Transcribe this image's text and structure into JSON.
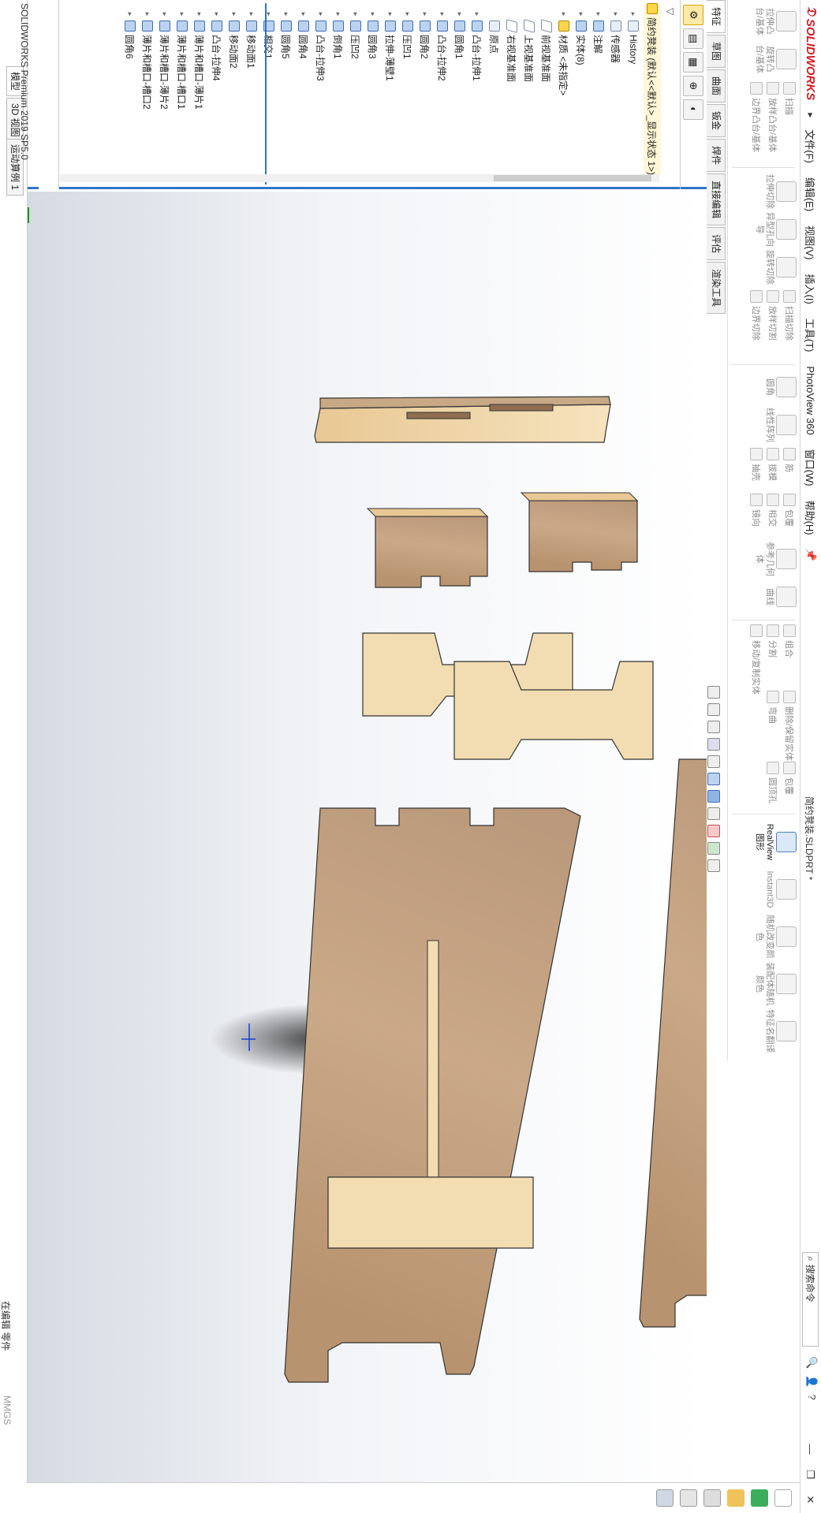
{
  "app": {
    "title": "SOLIDWORKS",
    "document_title": "简约凳装.SLDPRT *",
    "version_status": "SOLIDWORKS Premium 2019 SP5.0",
    "editing_status": "在编辑 零件",
    "units": "MMGS",
    "search_placeholder": "搜索命令"
  },
  "menu": {
    "items": [
      "文件(F)",
      "编辑(E)",
      "视图(V)",
      "插入(I)",
      "工具(T)",
      "PhotoView 360",
      "窗口(W)",
      "帮助(H)"
    ],
    "pin": "📌"
  },
  "ribbon": {
    "groups": [
      {
        "top": "拉伸凸台/基体",
        "bottom": "旋转凸台/基体"
      },
      {
        "top": "扫描",
        "mid": "放样凸台/基体",
        "bottom": "边界凸台/基体"
      },
      {
        "top": "拉伸切除",
        "bottom": "异型孔向导"
      },
      {
        "top": "旋转切除",
        "bottom": "扫描切除"
      },
      {
        "top": "放样切割",
        "bottom": "边界切除"
      },
      {
        "top": "圆角",
        "bottom": "线性阵列"
      },
      {
        "top": "筋",
        "mid": "拔模",
        "bottom": "抽壳"
      },
      {
        "top": "包覆",
        "mid": "相交",
        "bottom": "镜向"
      },
      {
        "top": "参考几何体",
        "bottom": "曲线"
      },
      {
        "top": "组合",
        "mid": "分割",
        "bottom": "移动/复制实体"
      },
      {
        "top": "删除/保留实体",
        "bottom": "弯曲"
      },
      {
        "top": "包覆",
        "bottom": "圆顶孔"
      },
      {
        "top": "RealView 图形",
        "bottom": "InstantID 随机变色"
      },
      {
        "top": "装配体随机颜色",
        "bottom": "多实体随机变色"
      },
      {
        "top": "特征名翻译",
        "bottom": "特征名翻译"
      }
    ],
    "realview_label": "RealView 图形",
    "instant3d_label": "Instant3D",
    "random_color_label": "随机改变颜色"
  },
  "tabs": [
    "特征",
    "草图",
    "曲面",
    "钣金",
    "焊件",
    "直接编辑",
    "评估",
    "渲染工具"
  ],
  "tabs_active": 0,
  "feature_tree": {
    "root": "简约凳装 (默认<<默认>_显示状态 1>)",
    "nodes": [
      {
        "label": "History",
        "icon": "history-icon"
      },
      {
        "label": "传感器",
        "icon": "sensor-icon"
      },
      {
        "label": "注解",
        "icon": "annotation-icon"
      },
      {
        "label": "实体(8)",
        "icon": "solid-bodies-icon"
      },
      {
        "label": "材质 <未指定>",
        "icon": "material-icon"
      },
      {
        "label": "前视基准面",
        "icon": "plane-icon"
      },
      {
        "label": "上视基准面",
        "icon": "plane-icon"
      },
      {
        "label": "右视基准面",
        "icon": "plane-icon"
      },
      {
        "label": "原点",
        "icon": "origin-icon"
      },
      {
        "label": "凸台-拉伸1",
        "icon": "extrude-icon"
      },
      {
        "label": "圆角1",
        "icon": "fillet-icon"
      },
      {
        "label": "凸台-拉伸2",
        "icon": "extrude-icon"
      },
      {
        "label": "圆角2",
        "icon": "fillet-icon"
      },
      {
        "label": "压凹1",
        "icon": "indent-icon"
      },
      {
        "label": "拉伸-薄壁1",
        "icon": "thin-extrude-icon"
      },
      {
        "label": "圆角3",
        "icon": "fillet-icon"
      },
      {
        "label": "压凹2",
        "icon": "indent-icon"
      },
      {
        "label": "倒角1",
        "icon": "chamfer-icon"
      },
      {
        "label": "凸台-拉伸3",
        "icon": "extrude-icon"
      },
      {
        "label": "圆角4",
        "icon": "fillet-icon"
      },
      {
        "label": "圆角5",
        "icon": "fillet-icon"
      },
      {
        "label": "相交1",
        "icon": "intersect-icon"
      },
      {
        "label": "移动面1",
        "icon": "move-face-icon"
      },
      {
        "label": "移动面2",
        "icon": "move-face-icon"
      },
      {
        "label": "凸台-拉伸4",
        "icon": "extrude-icon"
      },
      {
        "label": "薄片和槽口-薄片1",
        "icon": "tab-slot-icon"
      },
      {
        "label": "薄片和槽口-槽口1",
        "icon": "tab-slot-icon"
      },
      {
        "label": "薄片和槽口-薄片2",
        "icon": "tab-slot-icon"
      },
      {
        "label": "薄片和槽口-槽口2",
        "icon": "tab-slot-icon"
      },
      {
        "label": "圆角6",
        "icon": "fillet-icon"
      }
    ]
  },
  "bottom_tabs": [
    "模型",
    "3D 视图",
    "运动算例 1"
  ],
  "bottom_tabs_active": 0,
  "colors": {
    "accent": "#2f74c9",
    "brand": "#d51b22",
    "wood_face": "#c8a985",
    "wood_edge": "#f3dcae"
  },
  "icons": [
    "search-icon",
    "help-icon",
    "minimize-icon",
    "restore-icon",
    "close-icon",
    "filter-icon",
    "triad-icon"
  ]
}
